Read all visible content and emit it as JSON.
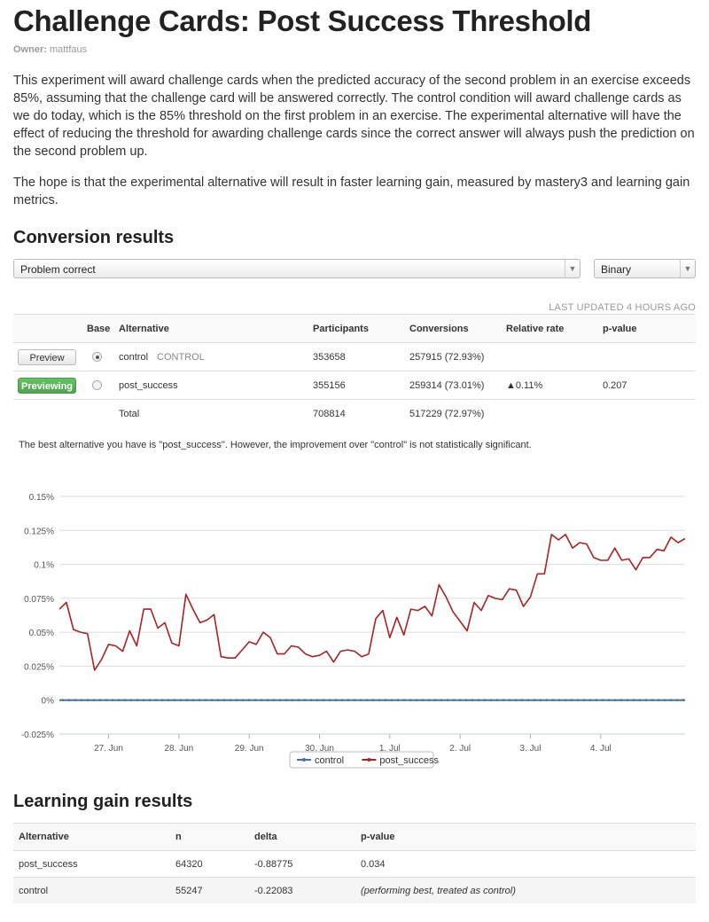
{
  "page": {
    "title": "Challenge Cards: Post Success Threshold",
    "owner_label": "Owner:",
    "owner": "mattfaus",
    "description_1": "This experiment will award challenge cards when the predicted accuracy of the second problem in an exercise exceeds 85%, assuming that the challenge card will be answered correctly. The control condition will award challenge cards as we do today, which is the 85% threshold on the first problem in an exercise. The experimental alternative will have the effect of reducing the threshold for awarding challenge cards since the correct answer will always push the prediction on the second problem up.",
    "description_2": "The hope is that the experimental alternative will result in faster learning gain, measured by mastery3 and learning gain metrics."
  },
  "conversion": {
    "heading": "Conversion results",
    "metric_select": "Problem correct",
    "type_select": "Binary",
    "last_updated": "LAST UPDATED 4 HOURS AGO",
    "columns": [
      "",
      "Base",
      "Alternative",
      "Participants",
      "Conversions",
      "Relative rate",
      "p-value"
    ],
    "rows": [
      {
        "button": "Preview",
        "base_selected": true,
        "alternative": "control",
        "tag": "CONTROL",
        "participants": "353658",
        "conversions": "257915 (72.93%)",
        "relative_rate": "",
        "p_value": ""
      },
      {
        "button": "Previewing",
        "base_selected": false,
        "alternative": "post_success",
        "tag": "",
        "participants": "355156",
        "conversions": "259314 (73.01%)",
        "relative_rate": "▲0.11%",
        "p_value": "0.207"
      }
    ],
    "total": {
      "label": "Total",
      "participants": "708814",
      "conversions": "517229 (72.97%)"
    },
    "summary": "The best alternative you have is \"post_success\". However, the improvement over \"control\" is not statistically significant."
  },
  "chart_data": {
    "type": "line",
    "title": "",
    "xlabel": "",
    "ylabel": "",
    "y_ticks": [
      "0.15%",
      "0.125%",
      "0.1%",
      "0.075%",
      "0.05%",
      "0.025%",
      "0%",
      "-0.025%"
    ],
    "ylim": [
      -0.025,
      0.15
    ],
    "x_ticks": [
      "27. Jun",
      "28. Jun",
      "29. Jun",
      "30. Jun",
      "1. Jul",
      "2. Jul",
      "3. Jul",
      "4. Jul"
    ],
    "x_range_days": [
      26.3,
      35.2
    ],
    "grid": true,
    "legend_position": "bottom-center",
    "series": [
      {
        "name": "control",
        "color": "#4572a7",
        "points": [
          [
            26.3,
            0
          ],
          [
            27,
            0
          ],
          [
            28,
            0
          ],
          [
            29,
            0
          ],
          [
            30,
            0
          ],
          [
            31,
            0
          ],
          [
            32,
            0
          ],
          [
            33,
            0
          ],
          [
            34,
            0
          ],
          [
            35,
            0
          ],
          [
            35.2,
            0
          ]
        ]
      },
      {
        "name": "post_success",
        "color": "#aa2222",
        "points": [
          [
            26.3,
            0.067
          ],
          [
            26.4,
            0.072
          ],
          [
            26.5,
            0.052
          ],
          [
            26.6,
            0.05
          ],
          [
            26.7,
            0.049
          ],
          [
            26.8,
            0.022
          ],
          [
            26.9,
            0.03
          ],
          [
            27.0,
            0.041
          ],
          [
            27.1,
            0.04
          ],
          [
            27.2,
            0.036
          ],
          [
            27.3,
            0.051
          ],
          [
            27.4,
            0.04
          ],
          [
            27.5,
            0.067
          ],
          [
            27.6,
            0.067
          ],
          [
            27.7,
            0.053
          ],
          [
            27.8,
            0.057
          ],
          [
            27.9,
            0.042
          ],
          [
            28.0,
            0.04
          ],
          [
            28.1,
            0.078
          ],
          [
            28.2,
            0.067
          ],
          [
            28.3,
            0.057
          ],
          [
            28.4,
            0.059
          ],
          [
            28.5,
            0.063
          ],
          [
            28.6,
            0.032
          ],
          [
            28.7,
            0.031
          ],
          [
            28.8,
            0.031
          ],
          [
            28.9,
            0.037
          ],
          [
            29.0,
            0.043
          ],
          [
            29.1,
            0.041
          ],
          [
            29.2,
            0.05
          ],
          [
            29.3,
            0.046
          ],
          [
            29.4,
            0.034
          ],
          [
            29.5,
            0.034
          ],
          [
            29.6,
            0.04
          ],
          [
            29.7,
            0.039
          ],
          [
            29.8,
            0.034
          ],
          [
            29.9,
            0.032
          ],
          [
            30.0,
            0.033
          ],
          [
            30.1,
            0.036
          ],
          [
            30.2,
            0.028
          ],
          [
            30.3,
            0.036
          ],
          [
            30.4,
            0.037
          ],
          [
            30.5,
            0.036
          ],
          [
            30.6,
            0.032
          ],
          [
            30.7,
            0.034
          ],
          [
            30.8,
            0.06
          ],
          [
            30.9,
            0.066
          ],
          [
            31.0,
            0.046
          ],
          [
            31.1,
            0.061
          ],
          [
            31.2,
            0.048
          ],
          [
            31.3,
            0.067
          ],
          [
            31.4,
            0.066
          ],
          [
            31.5,
            0.069
          ],
          [
            31.6,
            0.062
          ],
          [
            31.7,
            0.085
          ],
          [
            31.8,
            0.076
          ],
          [
            31.9,
            0.065
          ],
          [
            32.0,
            0.058
          ],
          [
            32.1,
            0.051
          ],
          [
            32.2,
            0.072
          ],
          [
            32.3,
            0.066
          ],
          [
            32.4,
            0.077
          ],
          [
            32.5,
            0.075
          ],
          [
            32.6,
            0.074
          ],
          [
            32.7,
            0.082
          ],
          [
            32.8,
            0.081
          ],
          [
            32.9,
            0.069
          ],
          [
            33.0,
            0.076
          ],
          [
            33.1,
            0.093
          ],
          [
            33.2,
            0.093
          ],
          [
            33.3,
            0.122
          ],
          [
            33.4,
            0.118
          ],
          [
            33.5,
            0.122
          ],
          [
            33.6,
            0.112
          ],
          [
            33.7,
            0.116
          ],
          [
            33.8,
            0.115
          ],
          [
            33.9,
            0.105
          ],
          [
            34.0,
            0.103
          ],
          [
            34.1,
            0.103
          ],
          [
            34.2,
            0.112
          ],
          [
            34.3,
            0.103
          ],
          [
            34.4,
            0.104
          ],
          [
            34.5,
            0.096
          ],
          [
            34.6,
            0.105
          ],
          [
            34.7,
            0.105
          ],
          [
            34.8,
            0.111
          ],
          [
            34.9,
            0.11
          ],
          [
            35.0,
            0.12
          ],
          [
            35.1,
            0.116
          ],
          [
            35.2,
            0.119
          ]
        ]
      }
    ]
  },
  "learning": {
    "heading": "Learning gain results",
    "columns": [
      "Alternative",
      "n",
      "delta",
      "p-value"
    ],
    "rows": [
      {
        "alternative": "post_success",
        "n": "64320",
        "delta": "-0.88775",
        "p_value": "0.034"
      },
      {
        "alternative": "control",
        "n": "55247",
        "delta": "-0.22083",
        "p_value": "(performing best, treated as control)"
      }
    ]
  }
}
